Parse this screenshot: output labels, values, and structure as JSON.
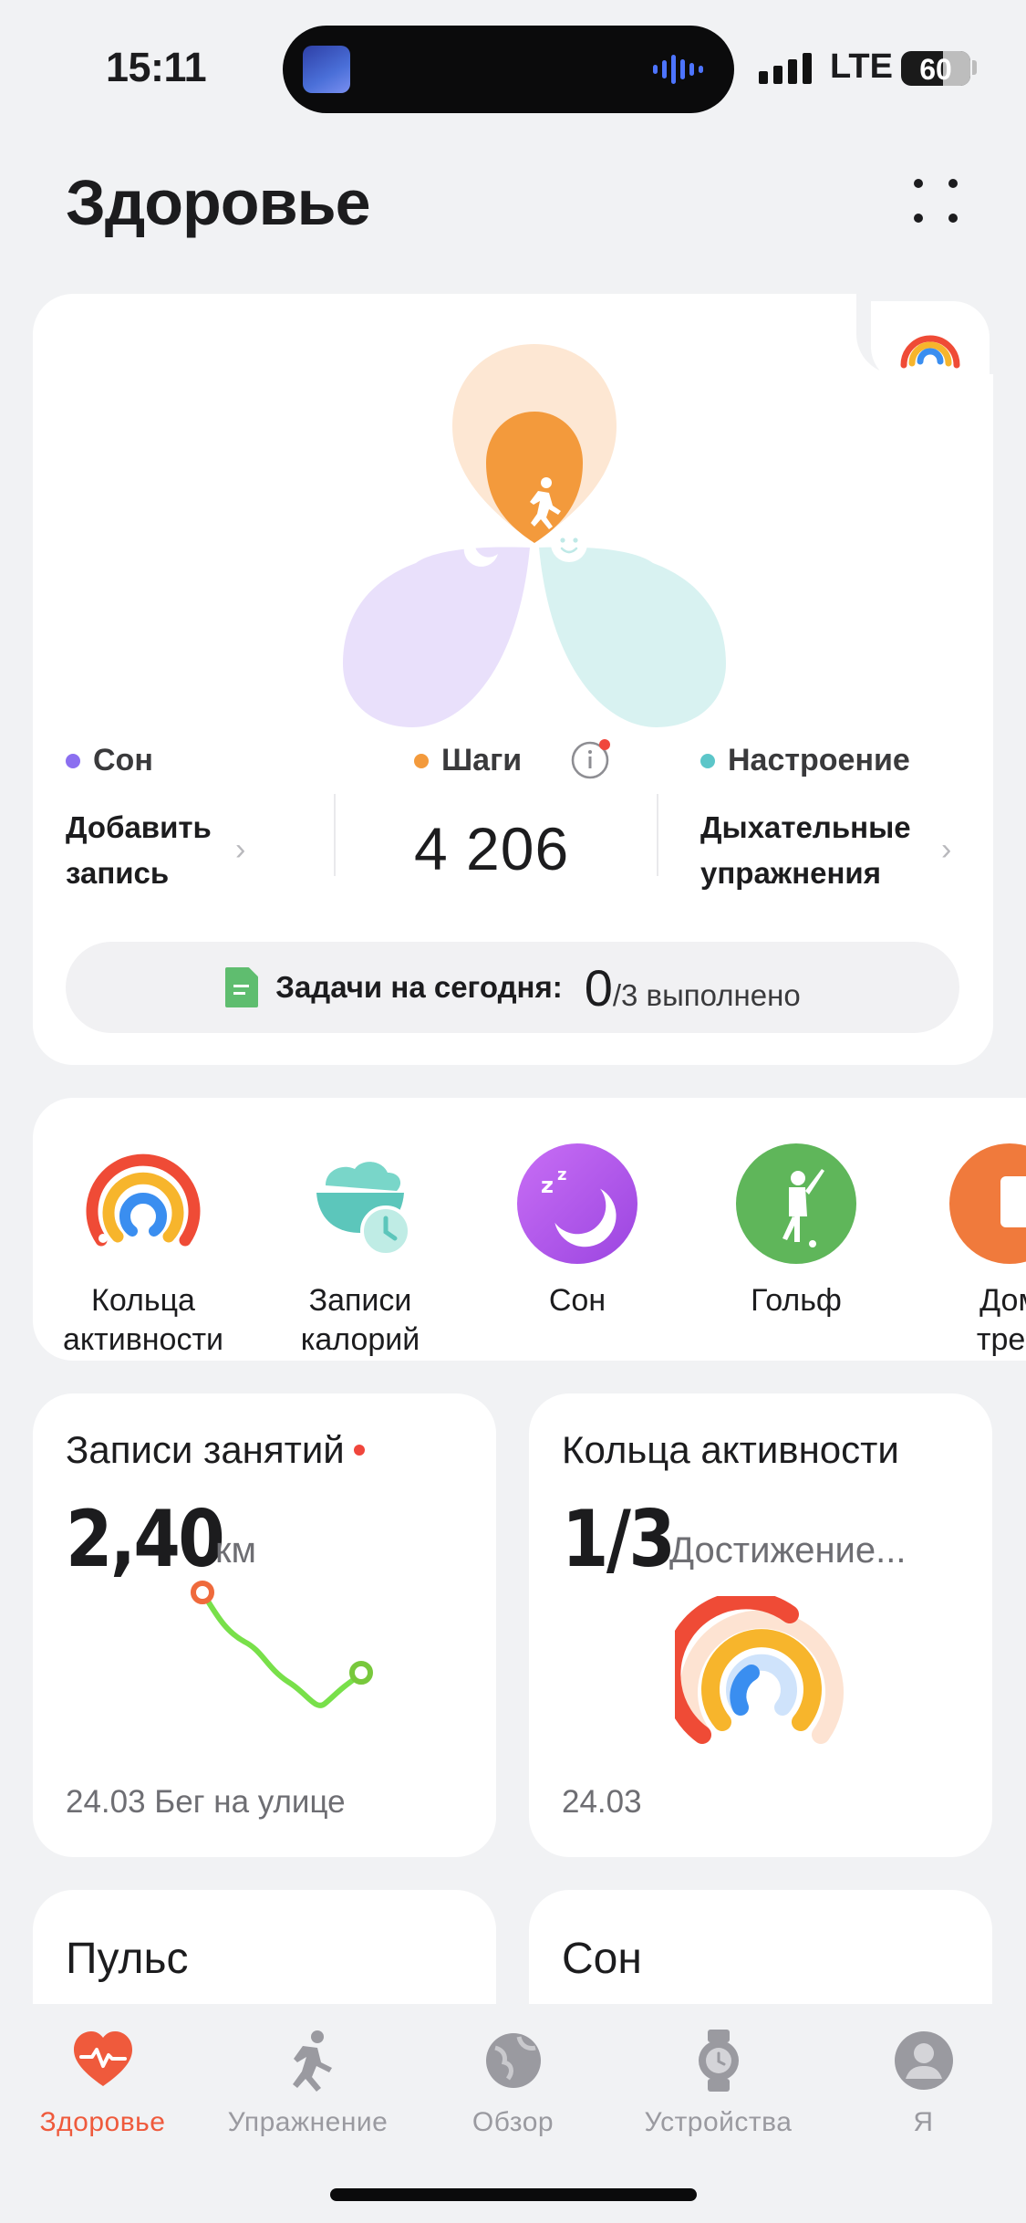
{
  "status_bar": {
    "time": "15:11",
    "network": "LTE",
    "battery": "60"
  },
  "header": {
    "title": "Здоровье"
  },
  "hero": {
    "metrics": [
      {
        "label": "Сон",
        "color": "#8b6ff0",
        "action_line1": "Добавить",
        "action_line2": "запись"
      },
      {
        "label": "Шаги",
        "color": "#f39a3c",
        "value": "4 206"
      },
      {
        "label": "Настроение",
        "color": "#5cc6c9",
        "action_line1": "Дыхательные",
        "action_line2": "упражнения"
      }
    ],
    "tasks": {
      "label": "Задачи на сегодня:",
      "done": "0",
      "rest": "/3 выполнено"
    }
  },
  "shortcuts": [
    {
      "label_line1": "Кольца",
      "label_line2": "активности",
      "icon": "activity-rings-icon"
    },
    {
      "label_line1": "Записи",
      "label_line2": "калорий",
      "icon": "calorie-records-icon"
    },
    {
      "label_line1": "Сон",
      "label_line2": "",
      "icon": "sleep-icon"
    },
    {
      "label_line1": "Гольф",
      "label_line2": "",
      "icon": "golf-icon"
    },
    {
      "label_line1": "Дом",
      "label_line2": "трен",
      "icon": "home-workout-icon"
    }
  ],
  "cards": {
    "activity": {
      "title": "Записи занятий",
      "value": "2,40",
      "unit": "км",
      "footer": "24.03 Бег на улице"
    },
    "rings": {
      "title": "Кольца активности",
      "value": "1/3",
      "subtitle": "Достижение...",
      "footer": "24.03"
    },
    "pulse": {
      "title": "Пульс"
    },
    "sleep": {
      "title": "Сон"
    }
  },
  "tabbar": [
    {
      "label": "Здоровье",
      "icon": "heart-pulse-icon",
      "active": true
    },
    {
      "label": "Упражнение",
      "icon": "running-icon",
      "active": false
    },
    {
      "label": "Обзор",
      "icon": "globe-icon",
      "active": false
    },
    {
      "label": "Устройства",
      "icon": "watch-icon",
      "active": false
    },
    {
      "label": "Я",
      "icon": "profile-icon",
      "active": false
    }
  ],
  "colors": {
    "accent": "#ef5a3c",
    "background": "#f1f2f4",
    "card": "#ffffff"
  }
}
